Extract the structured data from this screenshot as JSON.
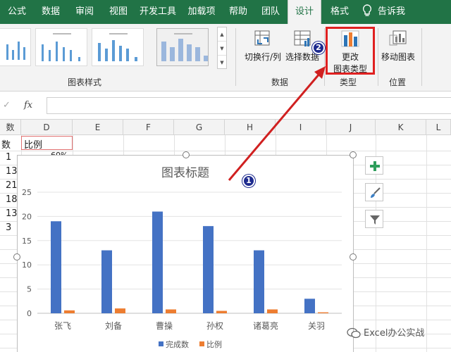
{
  "tabs": [
    {
      "label": "公式"
    },
    {
      "label": "数据"
    },
    {
      "label": "审阅"
    },
    {
      "label": "视图"
    },
    {
      "label": "开发工具"
    },
    {
      "label": "加载项"
    },
    {
      "label": "帮助"
    },
    {
      "label": "团队"
    },
    {
      "label": "设计"
    },
    {
      "label": "格式"
    }
  ],
  "tell_me": "告诉我",
  "ribbon": {
    "styles_group_label": "图表样式",
    "data_group_label": "数据",
    "type_group_label": "类型",
    "location_group_label": "位置",
    "switch_row_col": "切换行/列",
    "select_data": "选择数据",
    "change_type_line1": "更改",
    "change_type_line2": "图表类型",
    "move_chart": "移动图表"
  },
  "formula_bar": {
    "fx": "fx",
    "check": "✓"
  },
  "columns": [
    "数",
    "D",
    "E",
    "F",
    "G",
    "H",
    "I",
    "J",
    "K",
    "L"
  ],
  "cells": {
    "d_header": "比例",
    "c_header": "数",
    "c_values": [
      "1",
      "13",
      "21",
      "18",
      "13",
      "3"
    ],
    "d_first": "60%"
  },
  "chart_data": {
    "type": "bar",
    "title": "图表标题",
    "categories": [
      "张飞",
      "刘备",
      "曹操",
      "孙权",
      "诸葛亮",
      "关羽"
    ],
    "series": [
      {
        "name": "完成数",
        "values": [
          19,
          13,
          21,
          18,
          13,
          3
        ],
        "color": "#4472c4"
      },
      {
        "name": "比例",
        "values": [
          0.6,
          1.0,
          0.8,
          0.5,
          0.8,
          0.2
        ],
        "color": "#ed7d31"
      }
    ],
    "ylim": [
      0,
      25
    ],
    "yticks": [
      "0",
      "5",
      "10",
      "15",
      "20",
      "25"
    ],
    "grid": true,
    "legend": "bottom"
  },
  "badges": {
    "one": "1",
    "two": "2"
  },
  "watermark": "Excel办公实战",
  "colors": {
    "excel_green": "#217346",
    "highlight_red": "#e02020",
    "badge_blue": "#1e2b8f"
  }
}
